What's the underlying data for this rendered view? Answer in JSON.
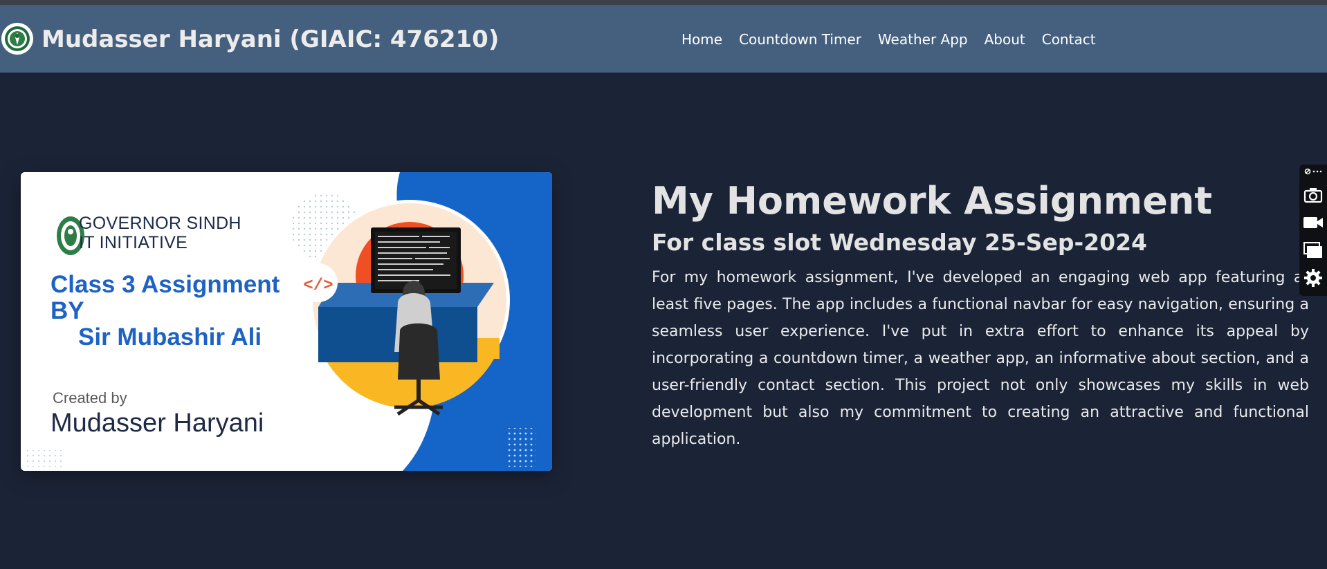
{
  "header": {
    "site_title": "Mudasser Haryani (GIAIC: 476210)",
    "logo_icon": "crest-logo-icon",
    "nav": [
      {
        "label": "Home"
      },
      {
        "label": "Countdown Timer"
      },
      {
        "label": "Weather App"
      },
      {
        "label": "About"
      },
      {
        "label": "Contact"
      }
    ]
  },
  "hero_image": {
    "org_line1": "GOVERNOR SINDH",
    "org_line2": "IT INITIATIVE",
    "heading_line1": "Class 3 Assignment",
    "heading_line2": "BY",
    "heading_line3": "Sir Mubashir Ali",
    "created_by_label": "Created by",
    "creator_name": "Mudasser Haryani",
    "code_badge": "</>",
    "colors": {
      "accent_blue": "#1d62c4",
      "orange": "#f04e23",
      "yellow": "#f9b823"
    }
  },
  "main": {
    "title": "My Homework Assignment",
    "subtitle": "For class slot Wednesday 25-Sep-2024",
    "description": "For my homework assignment, I've developed an engaging web app featuring at least five pages. The app includes a functional navbar for easy navigation, ensuring a seamless user experience. I've put in extra effort to enhance its appeal by incorporating a countdown timer, a weather app, an informative about section, and a user-friendly contact section. This project not only showcases my skills in web development but also my commitment to creating an attractive and functional application."
  },
  "toolbar": {
    "icons": [
      "extension-icon",
      "camera-icon",
      "video-icon",
      "window-icon",
      "gear-icon"
    ],
    "ellipsis": "⋯"
  },
  "colors": {
    "background": "#1b2437",
    "navbar": "#45607f"
  }
}
